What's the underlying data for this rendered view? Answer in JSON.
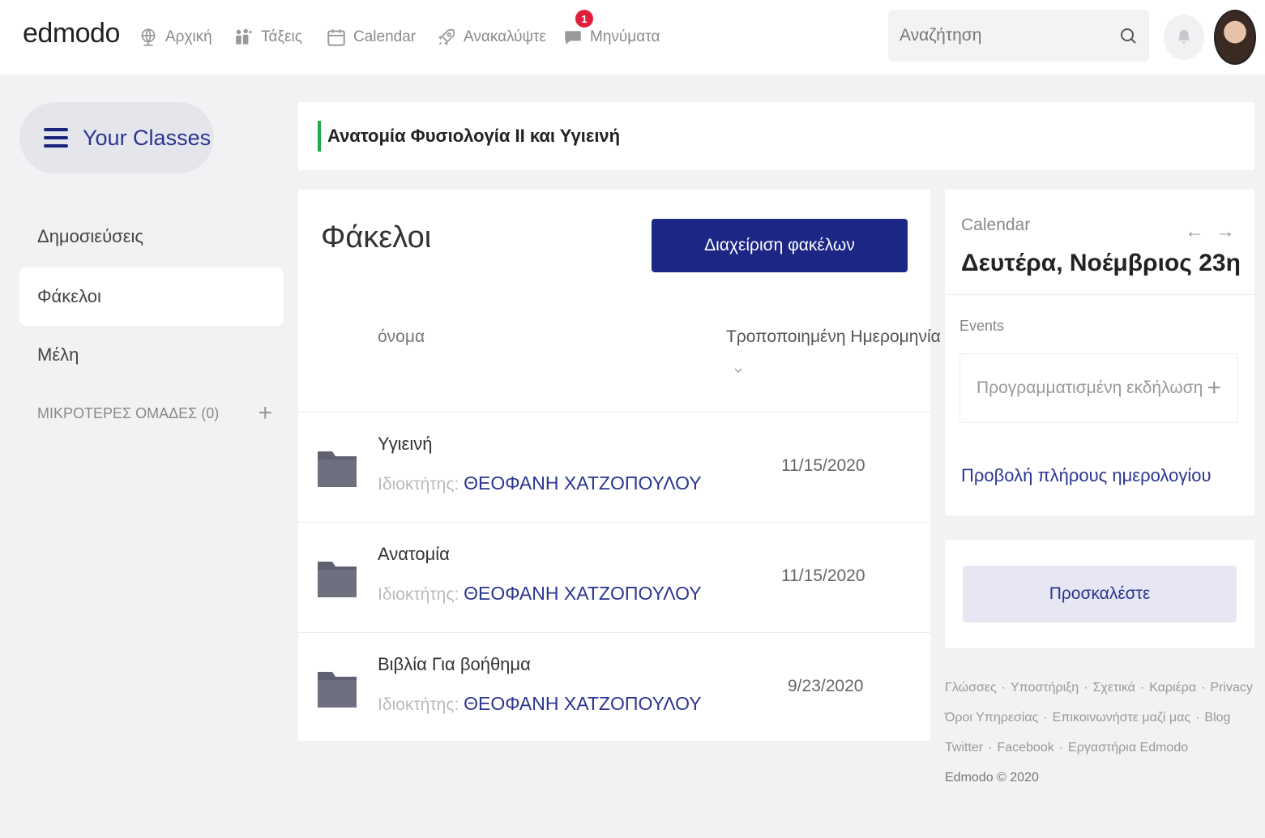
{
  "nav": {
    "logo": "edmodo",
    "items": [
      {
        "label": "Αρχική",
        "icon": "globe-icon"
      },
      {
        "label": "Τάξεις",
        "icon": "classes-icon"
      },
      {
        "label": "Calendar",
        "icon": "calendar-icon"
      },
      {
        "label": "Ανακαλύψτε",
        "icon": "rocket-icon"
      },
      {
        "label": "Μηνύματα",
        "icon": "messages-icon",
        "badge": "1"
      }
    ],
    "search_placeholder": "Αναζήτηση"
  },
  "sidebar": {
    "your_classes": "Your Classes",
    "items": [
      {
        "label": "Δημοσιεύσεις",
        "active": false
      },
      {
        "label": "Φάκελοι",
        "active": true
      },
      {
        "label": "Μέλη",
        "active": false
      }
    ],
    "small_groups": "ΜΙΚΡΟΤΕΡΕΣ ΟΜΑΔΕΣ (0)"
  },
  "class_title": "Ανατομία Φυσιολογία ΙΙ και Υγιεινή",
  "folders": {
    "title": "Φάκελοι",
    "manage_button": "Διαχείριση φακέλων",
    "col_name": "όνομα",
    "col_date": "Τροποποιημένη Ημερομηνία",
    "owner_label": "Ιδιοκτήτης:",
    "rows": [
      {
        "name": "Υγιεινή",
        "owner": "ΘΕΟΦΑΝΗ ΧΑΤΖΟΠΟΥΛΟΥ",
        "date": "11/15/2020"
      },
      {
        "name": "Ανατομία",
        "owner": "ΘΕΟΦΑΝΗ ΧΑΤΖΟΠΟΥΛΟΥ",
        "date": "11/15/2020"
      },
      {
        "name": "Βιβλία Για βοήθημα",
        "owner": "ΘΕΟΦΑΝΗ ΧΑΤΖΟΠΟΥΛΟΥ",
        "date": "9/23/2020"
      }
    ]
  },
  "calendar": {
    "label": "Calendar",
    "date": "Δευτέρα, Νοέμβριος 23η",
    "events_label": "Events",
    "scheduled_event": "Προγραμματισμένη εκδήλωση",
    "full_calendar": "Προβολή πλήρους ημερολογίου"
  },
  "invite_button": "Προσκαλέστε",
  "footer": {
    "links": [
      "Γλώσσες",
      "Υποστήριξη",
      "Σχετικά",
      "Καριέρα",
      "Privacy",
      "Όροι Υπηρεσίας",
      "Επικοινωνήστε μαζί μας",
      "Blog",
      "Twitter",
      "Facebook",
      "Εργαστήρια Edmodo"
    ],
    "copyright": "Edmodo © 2020"
  },
  "colors": {
    "brand_navy": "#1b2685",
    "link_blue": "#2a3590",
    "class_accent": "#1eaa4c",
    "badge_red": "#e0203a"
  }
}
